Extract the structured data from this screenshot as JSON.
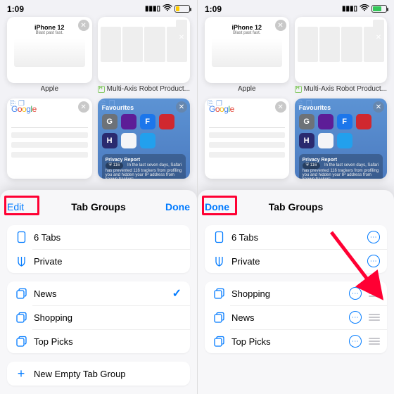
{
  "status": {
    "time": "1:09"
  },
  "tabs": {
    "apple": "Apple",
    "robot": "Multi-Axis Robot Product...",
    "google_logo": "Google"
  },
  "startpage": {
    "favourites": "Favourites",
    "privacy_title": "Privacy Report",
    "privacy_badge": "⛨ 116",
    "privacy_text": "In the last seven days, Safari has prevented 116 trackers from profiling you and hidden your IP address from known trackers."
  },
  "left": {
    "edit": "Edit",
    "title": "Tab Groups",
    "done": "Done",
    "tabs_count": "6 Tabs",
    "private": "Private",
    "groups": [
      "News",
      "Shopping",
      "Top Picks"
    ],
    "new_group": "New Empty Tab Group"
  },
  "right": {
    "done": "Done",
    "title": "Tab Groups",
    "tabs_count": "6 Tabs",
    "private": "Private",
    "groups": [
      "Shopping",
      "News",
      "Top Picks"
    ]
  },
  "thumb": {
    "iphone_title": "iPhone 12",
    "iphone_sub": "Blast past fast."
  }
}
